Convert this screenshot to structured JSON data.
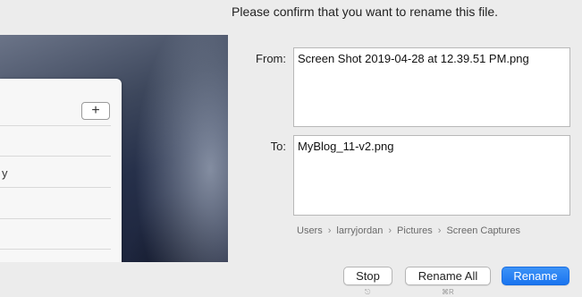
{
  "header": {
    "text": "Please confirm that you want to rename this file."
  },
  "from": {
    "label": "From:",
    "value": "Screen Shot 2019-04-28 at 12.39.51 PM.png"
  },
  "to": {
    "label": "To:",
    "value": "MyBlog_11-v2.png"
  },
  "path": {
    "segments": [
      "Users",
      "larryjordan",
      "Pictures",
      "Screen Captures"
    ],
    "separator": "›"
  },
  "preview": {
    "plus_label": "+",
    "fragment_text": "y"
  },
  "buttons": {
    "stop": "Stop",
    "rename_all": "Rename All",
    "rename": "Rename",
    "stop_hint": "⎋",
    "rename_all_hint": "⌘R"
  },
  "colors": {
    "accent": "#1a74ef",
    "window_bg": "#ececec"
  }
}
